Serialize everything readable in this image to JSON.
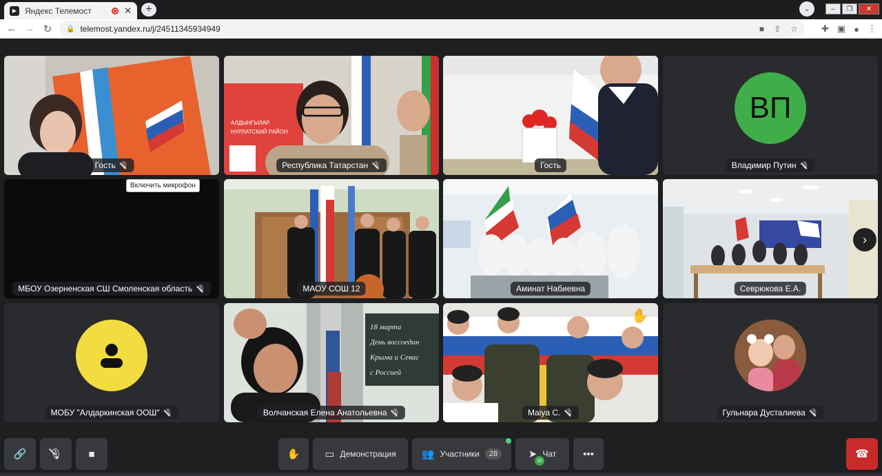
{
  "browser": {
    "tab_title": "Яндекс Телемост",
    "url": "telemost.yandex.ru/j/24511345934949"
  },
  "tiles": [
    {
      "name": "Гость",
      "muted": true,
      "scene": "girl-flag-orange"
    },
    {
      "name": "Республика Татарстан",
      "muted": true,
      "scene": "teacher-waving"
    },
    {
      "name": "Гость",
      "muted": false,
      "scene": "woman-flag",
      "active": true
    },
    {
      "name": "Владимир Путин",
      "muted": true,
      "initials": "ВП",
      "color": "#3fae49"
    },
    {
      "name": "МБОУ Озерненская СШ Смоленская область",
      "muted": true,
      "scene": "black"
    },
    {
      "name": "МАОУ СОШ 12",
      "muted": false,
      "scene": "cadets"
    },
    {
      "name": "Аминат Набиевна",
      "muted": false,
      "scene": "classroom-girls"
    },
    {
      "name": "Севрюкова Е.А.",
      "muted": false,
      "scene": "classroom-wide"
    },
    {
      "name": "МОБУ \"Алдаркинская ООШ\"",
      "muted": true,
      "avatar": "user-icon",
      "color": "#f2dc3f"
    },
    {
      "name": "Волчанская Елена Анатольевна",
      "muted": true,
      "scene": "blackboard"
    },
    {
      "name": "Maiya C.",
      "muted": true,
      "scene": "kids-flags"
    },
    {
      "name": "Гульнара Дусталиева",
      "muted": true,
      "scene": "photo-avatar"
    }
  ],
  "tooltip": "Включить микрофон",
  "blackboard_text": [
    "18 марта",
    "День воссоедин",
    "Крыма и Севас",
    "с Россией"
  ],
  "banner_text": [
    "АЛДЫНГЫЛАР",
    "НУРЛАТСКИЙ РАЙОН"
  ],
  "toolbar": {
    "demo_label": "Демонстрация",
    "participants_label": "Участники",
    "participants_count": "28",
    "chat_label": "Чат",
    "chat_badge": "20"
  },
  "colors": {
    "accent_active": "#f5c518",
    "hangup": "#c92a2a"
  }
}
